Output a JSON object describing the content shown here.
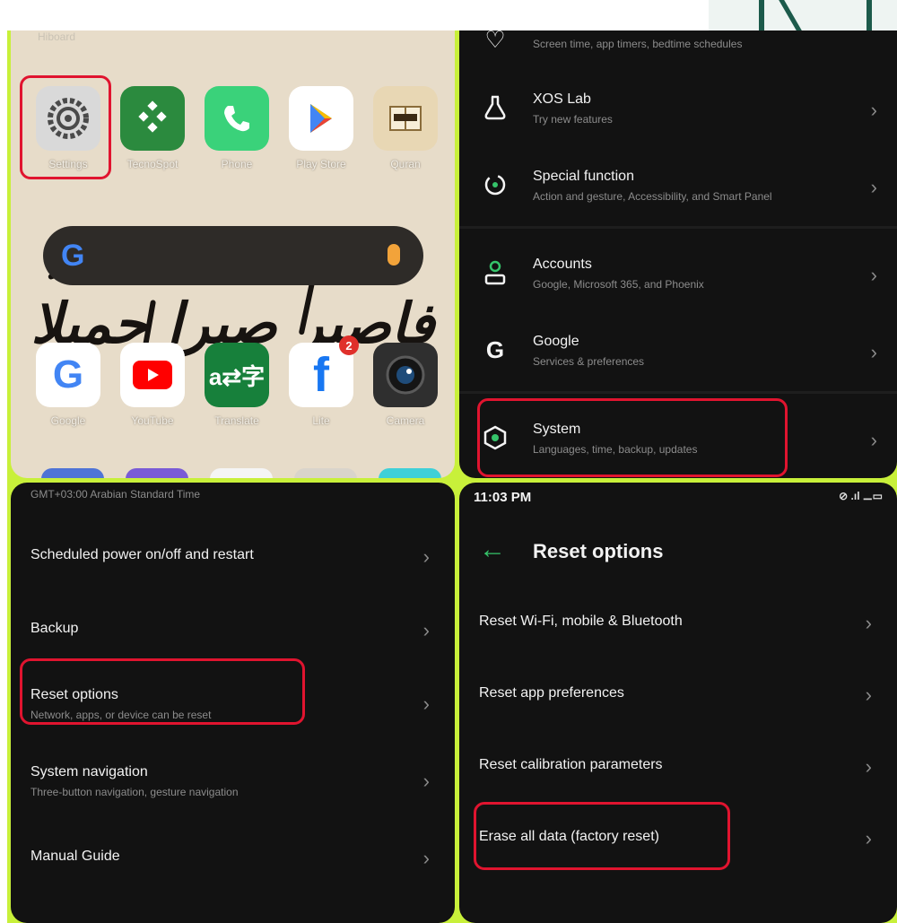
{
  "home": {
    "top_label": "Hiboard",
    "top_row": [
      {
        "label": "Settings",
        "icon": "settings-gear-icon",
        "color": "#d9d9d9"
      },
      {
        "label": "TecnoSpot",
        "icon": "pattern-app-icon",
        "color": "#2b8a3e"
      },
      {
        "label": "Phone",
        "icon": "phone-icon",
        "color": "#3ad27a"
      },
      {
        "label": "Play Store",
        "icon": "play-store-icon",
        "color": "#ffffff"
      },
      {
        "label": "Quran",
        "icon": "quran-app-icon",
        "color": "#e8d7b4"
      }
    ],
    "search": {
      "logo": "G",
      "mic_icon": "mic-icon"
    },
    "bottom_row": [
      {
        "label": "Google",
        "icon": "google-icon",
        "color": "#ffffff"
      },
      {
        "label": "YouTube",
        "icon": "youtube-icon",
        "color": "#ffffff"
      },
      {
        "label": "Translate",
        "icon": "translate-icon",
        "color": "#17803b"
      },
      {
        "label": "Lite",
        "icon": "facebook-icon",
        "color": "#ffffff",
        "badge": "2"
      },
      {
        "label": "Camera",
        "icon": "camera-icon",
        "color": "#2f2f2f"
      }
    ],
    "wallpaper_text": "فاصبر صبرا جميلا"
  },
  "settings": {
    "partial_row_sub": "Screen time, app timers, bedtime schedules",
    "rows": [
      {
        "title": "XOS Lab",
        "sub": "Try new features",
        "icon": "flask-icon"
      },
      {
        "title": "Special function",
        "sub": "Action and gesture, Accessibility, and Smart Panel",
        "icon": "gesture-icon"
      },
      {
        "title": "Accounts",
        "sub": "Google, Microsoft 365, and Phoenix",
        "icon": "account-icon"
      },
      {
        "title": "Google",
        "sub": "Services & preferences",
        "icon": "google-g-icon"
      },
      {
        "title": "System",
        "sub": "Languages, time, backup, updates",
        "icon": "system-hex-icon"
      }
    ]
  },
  "system": {
    "partial_top": "GMT+03:00 Arabian Standard Time",
    "rows": [
      {
        "title": "Scheduled power on/off and restart",
        "sub": ""
      },
      {
        "title": "Backup",
        "sub": ""
      },
      {
        "title": "Reset options",
        "sub": "Network, apps, or device can be reset"
      },
      {
        "title": "System navigation",
        "sub": "Three-button navigation, gesture navigation"
      },
      {
        "title": "Manual Guide",
        "sub": ""
      }
    ]
  },
  "reset": {
    "time": "11:03 PM",
    "status_icons": "⊘ .ıl ⚊▭",
    "title": "Reset options",
    "rows": [
      {
        "title": "Reset Wi-Fi, mobile & Bluetooth"
      },
      {
        "title": "Reset app preferences"
      },
      {
        "title": "Reset calibration parameters"
      },
      {
        "title": "Erase all data (factory reset)"
      }
    ]
  },
  "colors": {
    "highlight": "#e0142f",
    "frame": "#c8f03a",
    "accent": "#35c46a"
  }
}
